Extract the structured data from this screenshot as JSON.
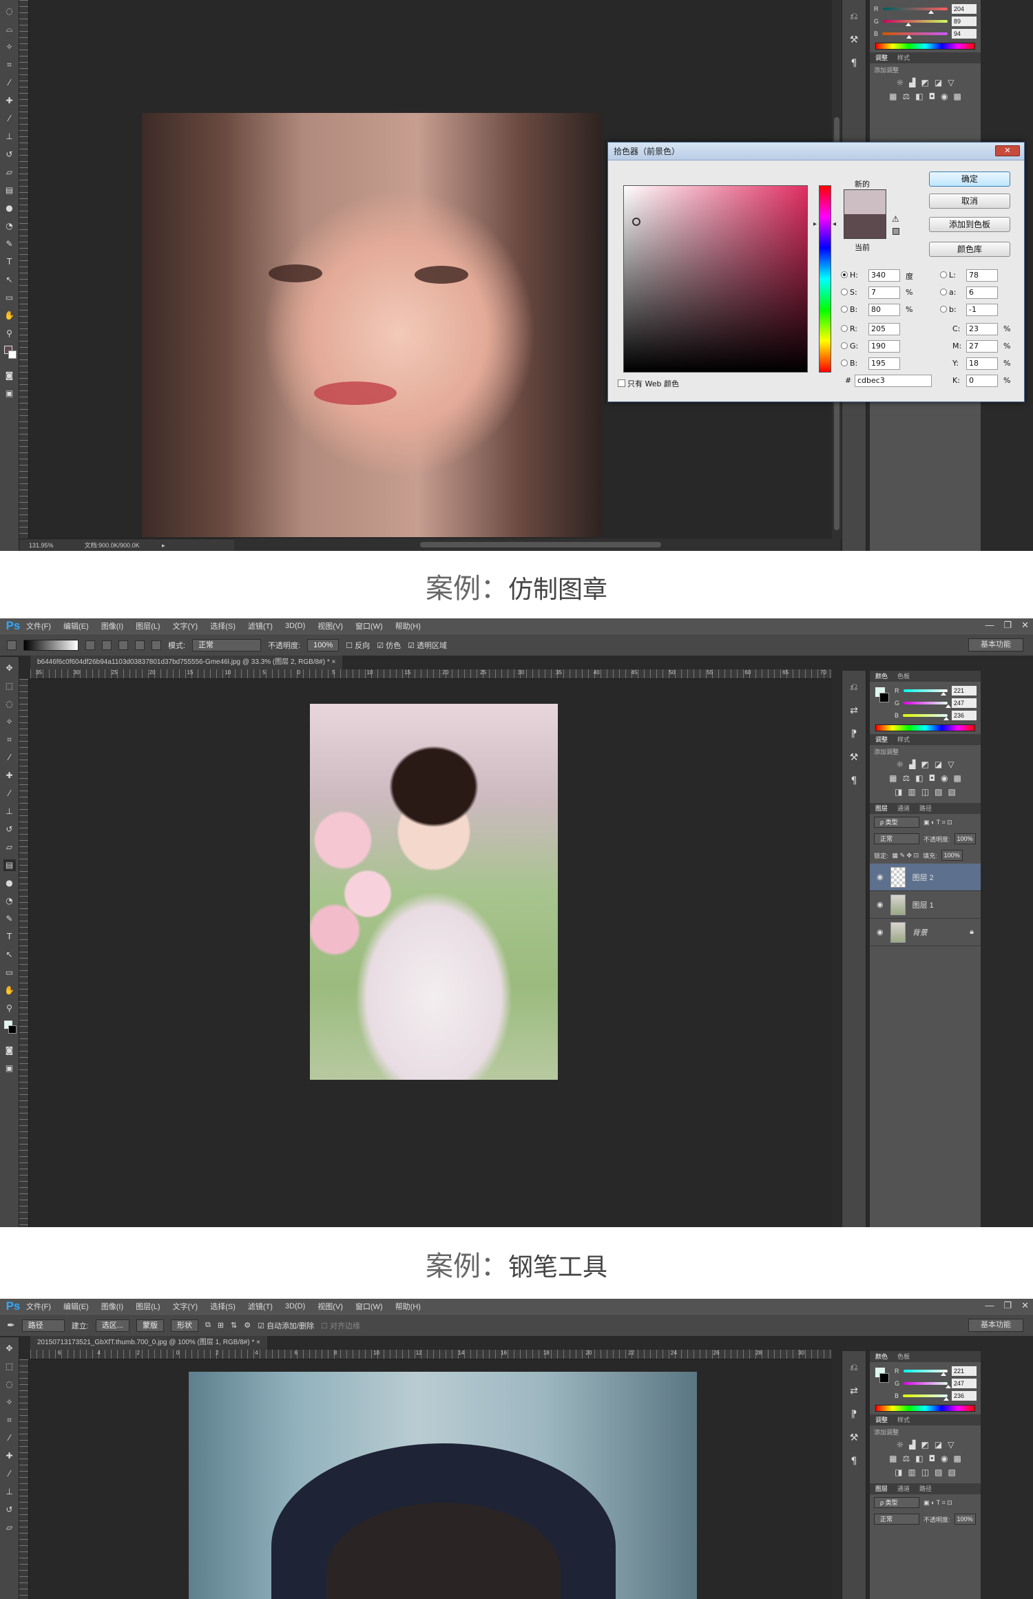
{
  "captions": {
    "pre": "案例：",
    "clone_title": "仿制图章",
    "pen_title": "钢笔工具"
  },
  "window": {
    "logo": "Ps",
    "menu": [
      "文件(F)",
      "编辑(E)",
      "图像(I)",
      "图层(L)",
      "文字(Y)",
      "选择(S)",
      "滤镜(T)",
      "3D(D)",
      "视图(V)",
      "窗口(W)",
      "帮助(H)"
    ],
    "workspace": "基本功能",
    "minimize": "—",
    "restore": "❐",
    "close": "✕"
  },
  "shot1": {
    "zoom": "131.95%",
    "doc_info": "文档:900.0K/900.0K",
    "color_picker": {
      "title": "拾色器（前景色）",
      "close": "✕",
      "new_label": "新的",
      "current_label": "当前",
      "new_color": "#cdbec3",
      "current_color": "#5c4a4f",
      "buttons": {
        "ok": "确定",
        "cancel": "取消",
        "add_swatch": "添加到色板",
        "libraries": "颜色库"
      },
      "web_only": "只有 Web 颜色",
      "h": {
        "label": "H:",
        "value": "340",
        "unit": "度"
      },
      "s": {
        "label": "S:",
        "value": "7",
        "unit": "%"
      },
      "b": {
        "label": "B:",
        "value": "80",
        "unit": "%"
      },
      "r": {
        "label": "R:",
        "value": "205"
      },
      "g": {
        "label": "G:",
        "value": "190"
      },
      "bb": {
        "label": "B:",
        "value": "195"
      },
      "l": {
        "label": "L:",
        "value": "78"
      },
      "a": {
        "label": "a:",
        "value": "6"
      },
      "lb": {
        "label": "b:",
        "value": "-1"
      },
      "c": {
        "label": "C:",
        "value": "23",
        "unit": "%"
      },
      "m": {
        "label": "M:",
        "value": "27",
        "unit": "%"
      },
      "y": {
        "label": "Y:",
        "value": "18",
        "unit": "%"
      },
      "k": {
        "label": "K:",
        "value": "0",
        "unit": "%"
      },
      "hex_label": "#",
      "hex": "cdbec3"
    },
    "panel": {
      "r": "204",
      "g": "89",
      "b": "94",
      "tab_adjust": "调整",
      "tab_style": "样式",
      "add_adjustment": "添加调整"
    }
  },
  "shot2": {
    "options": {
      "mode_label": "模式:",
      "mode_value": "正常",
      "opacity_label": "不透明度:",
      "opacity_value": "100%",
      "reverse": "反向",
      "dither": "仿色",
      "transparency": "透明区域"
    },
    "doc_tab": "b6446f6c0f604df26b94a1103d03837801d37bd755556-Gme46l.jpg @ 33.3% (图层 2, RGB/8#) *  ×",
    "panel": {
      "tab_color": "颜色",
      "tab_swatch": "色板",
      "r": "221",
      "g": "247",
      "b": "236",
      "tab_adjust": "调整",
      "tab_style": "样式",
      "add_adjustment": "添加调整",
      "tab_layers": "图层",
      "tab_channels": "通道",
      "tab_paths": "路径",
      "kind": "ρ 类型",
      "blend": "正常",
      "opacity_label": "不透明度:",
      "opacity": "100%",
      "lock_label": "锁定:",
      "fill_label": "填充:",
      "fill": "100%",
      "layers": [
        "图层 2",
        "图层 1",
        "背景"
      ]
    }
  },
  "shot3": {
    "options": {
      "path": "路径",
      "make": "建立:",
      "selection": "选区...",
      "mask": "蒙版",
      "shape": "形状",
      "auto_add": "自动添加/删除",
      "align_edges": "对齐边缘"
    },
    "doc_tab": "20150713173521_GbXfT.thumb.700_0.jpg @ 100% (图层 1, RGB/8#) *  ×",
    "panel": {
      "tab_color": "颜色",
      "tab_swatch": "色板",
      "r": "221",
      "g": "247",
      "b": "236",
      "tab_adjust": "调整",
      "tab_style": "样式",
      "add_adjustment": "添加调整",
      "tab_layers": "图层",
      "tab_channels": "通道",
      "tab_paths": "路径",
      "kind": "ρ 类型",
      "blend": "正常",
      "opacity_label": "不透明度:",
      "opacity": "100%"
    }
  },
  "ruler_ticks_2": [
    "35",
    "30",
    "25",
    "20",
    "15",
    "10",
    "5",
    "0",
    "5",
    "10",
    "15",
    "20",
    "25",
    "30",
    "35",
    "40",
    "45",
    "50",
    "55",
    "60",
    "65",
    "70"
  ],
  "ruler_ticks_3": [
    "6",
    "4",
    "2",
    "0",
    "2",
    "4",
    "6",
    "8",
    "10",
    "12",
    "14",
    "16",
    "18",
    "20",
    "22",
    "24",
    "26",
    "28",
    "30"
  ]
}
